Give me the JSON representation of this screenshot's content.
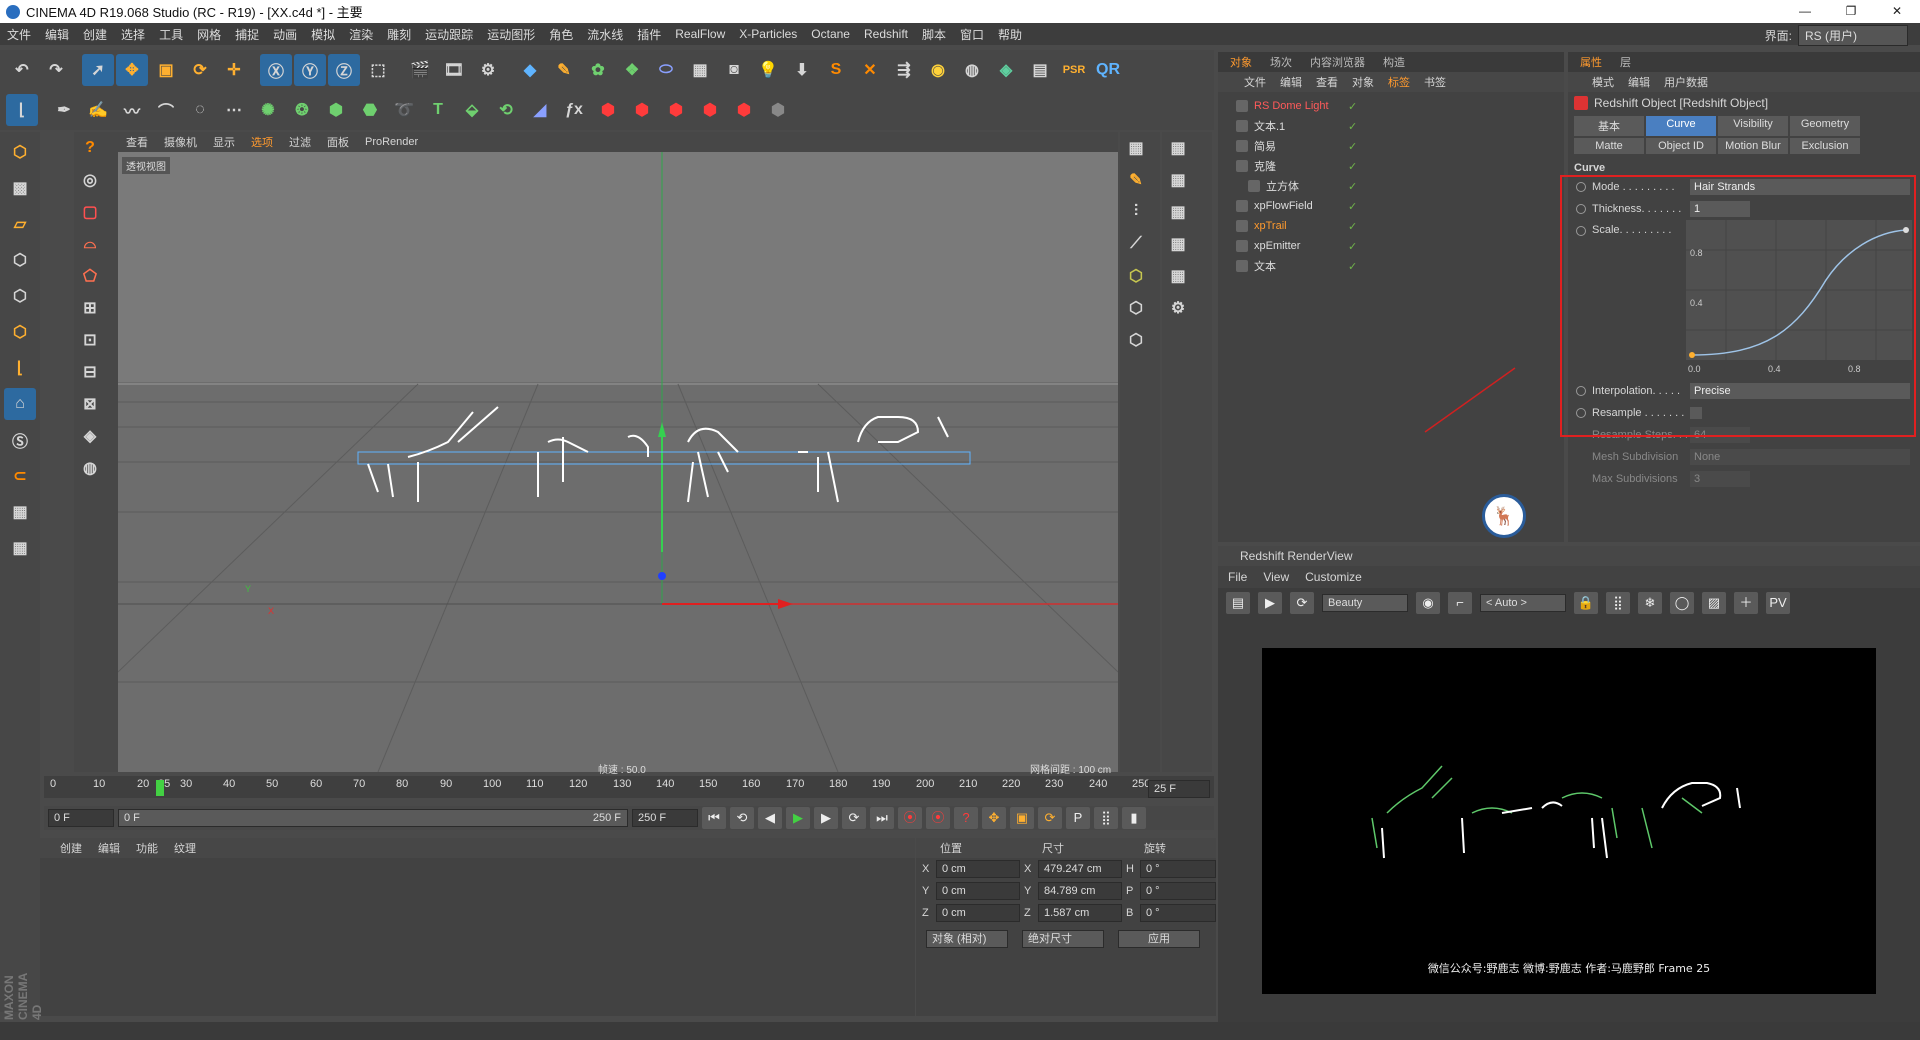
{
  "window": {
    "title": "CINEMA 4D R19.068 Studio (RC - R19) - [XX.c4d *] - 主要",
    "controls": [
      "—",
      "❐",
      "✕"
    ]
  },
  "menubar": [
    "文件",
    "编辑",
    "创建",
    "选择",
    "工具",
    "网格",
    "捕捉",
    "动画",
    "模拟",
    "渲染",
    "雕刻",
    "运动跟踪",
    "运动图形",
    "角色",
    "流水线",
    "插件",
    "RealFlow",
    "X-Particles",
    "Octane",
    "Redshift",
    "脚本",
    "窗口",
    "帮助"
  ],
  "interface": {
    "label": "界面:",
    "value": "RS (用户)"
  },
  "viewport": {
    "menu": [
      "查看",
      "摄像机",
      "显示",
      "选项",
      "过滤",
      "面板",
      "ProRender"
    ],
    "label": "透视视图",
    "fps": "帧速 : 50.0",
    "grid": "网格间距 : 100 cm"
  },
  "timeline": {
    "ticks": [
      "0",
      "10",
      "20",
      "25",
      "30",
      "40",
      "50",
      "60",
      "70",
      "80",
      "90",
      "100",
      "110",
      "120",
      "130",
      "140",
      "150",
      "160",
      "170",
      "180",
      "190",
      "200",
      "210",
      "220",
      "230",
      "240",
      "250"
    ],
    "current": "25 F"
  },
  "playback": {
    "start": "0 F",
    "range_start": "0 F",
    "range_end": "250 F",
    "end": "250 F"
  },
  "material_menu": [
    "创建",
    "编辑",
    "功能",
    "纹理"
  ],
  "coords": {
    "headers": [
      "位置",
      "尺寸",
      "旋转"
    ],
    "rows": [
      {
        "axis": "X",
        "pos": "0 cm",
        "size": "479.247 cm",
        "rlab": "H",
        "rot": "0 °"
      },
      {
        "axis": "Y",
        "pos": "0 cm",
        "size": "84.789 cm",
        "rlab": "P",
        "rot": "0 °"
      },
      {
        "axis": "Z",
        "pos": "0 cm",
        "size": "1.587 cm",
        "rlab": "B",
        "rot": "0 °"
      }
    ],
    "mode1": "对象 (相对)",
    "mode2": "绝对尺寸",
    "apply": "应用"
  },
  "object_panel": {
    "tabs": [
      "对象",
      "场次",
      "内容浏览器",
      "构造"
    ],
    "menu": [
      "文件",
      "编辑",
      "查看",
      "对象",
      "标签",
      "书签"
    ],
    "objects": [
      "RS Dome Light",
      "文本.1",
      "简易",
      "克隆",
      "立方体",
      "xpFlowField",
      "xpTrail",
      "xpEmitter",
      "文本"
    ]
  },
  "attr_panel": {
    "tabs": [
      "属性",
      "层"
    ],
    "menu": [
      "模式",
      "编辑",
      "用户数据"
    ],
    "object_title": "Redshift Object [Redshift Object]",
    "tab_grid": [
      "基本",
      "Curve",
      "Visibility",
      "Geometry",
      "Matte",
      "Object ID",
      "Motion Blur",
      "Exclusion"
    ],
    "section": "Curve",
    "mode_label": "Mode . . . . . . . . .",
    "mode_value": "Hair Strands",
    "thickness_label": "Thickness. . . . . . .",
    "thickness_value": "1",
    "scale_label": "Scale. . . . . . . . .",
    "curve_ticks_y": [
      "0.8",
      "0.4"
    ],
    "curve_ticks_x": [
      "0.0",
      "0.4",
      "0.8"
    ],
    "interp_label": "Interpolation. . . . .",
    "interp_value": "Precise",
    "resample_label": "Resample . . . . . . .",
    "resample_steps_label": "Resample Steps. . .",
    "resample_steps_value": "64",
    "mesh_sub_label": "Mesh Subdivision",
    "mesh_sub_value": "None",
    "max_sub_label": "Max Subdivisions",
    "max_sub_value": "3"
  },
  "renderview": {
    "title": "Redshift RenderView",
    "menu": [
      "File",
      "View",
      "Customize"
    ],
    "aov": "Beauty",
    "zoom": "< Auto >",
    "caption": "微信公众号:野鹿志  微博:野鹿志  作者:马鹿野郎  Frame  25"
  },
  "brand": "MAXON CINEMA 4D",
  "colors": {
    "accent": "#ff9a2e",
    "selected_tab": "#4a7fc1",
    "highlight": "#e02020"
  }
}
